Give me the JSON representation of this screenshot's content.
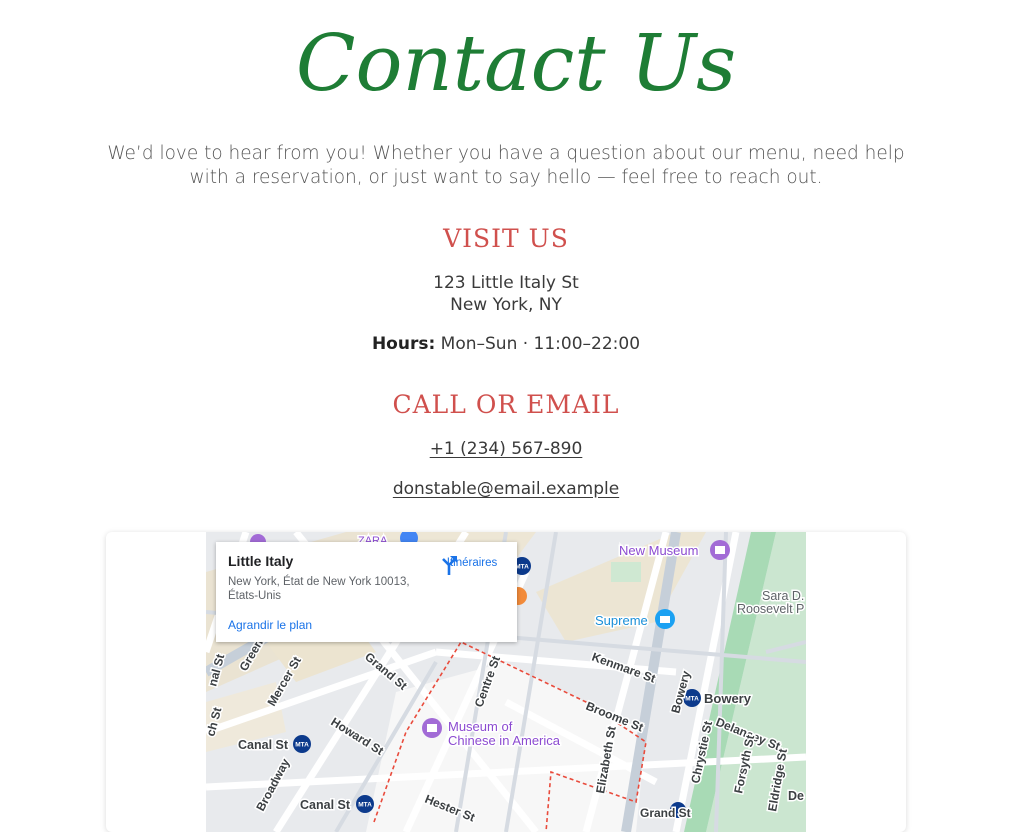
{
  "page": {
    "title": "Contact Us",
    "intro": "We’d love to hear from you! Whether you have a question about our menu, need help with a reservation, or just want to say hello — feel free to reach out.",
    "visit_heading": "VISIT US",
    "address_line1": "123 Little Italy St",
    "address_line2": "New York, NY",
    "hours_label": "Hours:",
    "hours_value": "Mon–Sun · 11:00–22:00",
    "call_heading": "CALL OR EMAIL",
    "phone": "+1 (234) 567-890",
    "email": "donstable@email.example",
    "colors": {
      "title_green": "#1e7d35",
      "heading_red": "#d0504d",
      "map_link_blue": "#1a73e8"
    }
  },
  "map": {
    "info": {
      "name": "Little Italy",
      "address": "New York, État de New York 10013, États-Unis",
      "directions": "Itinéraires",
      "enlarge": "Agrandir le plan"
    },
    "labels": {
      "new_museum": "New Museum",
      "sara": "Sara D.",
      "roosevelt": "Roosevelt P",
      "supreme": "Supreme",
      "zara": "ZARA",
      "kenmare": "Kenmare St",
      "bowery": "Bowery",
      "bowery_st": "Bowery",
      "broome": "Broome St",
      "delancey": "Delancey St",
      "centre": "Centre St",
      "grand1": "Grand St",
      "mercer": "Mercer St",
      "greene": "Greene",
      "howard": "Howard St",
      "canal1": "Canal St",
      "canal2": "Canal St",
      "museum1": "Museum of",
      "museum2": "Chinese in America",
      "elizabeth": "Elizabeth St",
      "chrystie": "Chrystie St",
      "forsyth": "Forsyth St",
      "eldridge": "Eldridge St",
      "broadway": "Broadway",
      "hester": "Hester St",
      "grand2": "Grand St",
      "nal": "nal St",
      "chst": "ch St",
      "de": "De",
      "mta": "MTA"
    }
  }
}
